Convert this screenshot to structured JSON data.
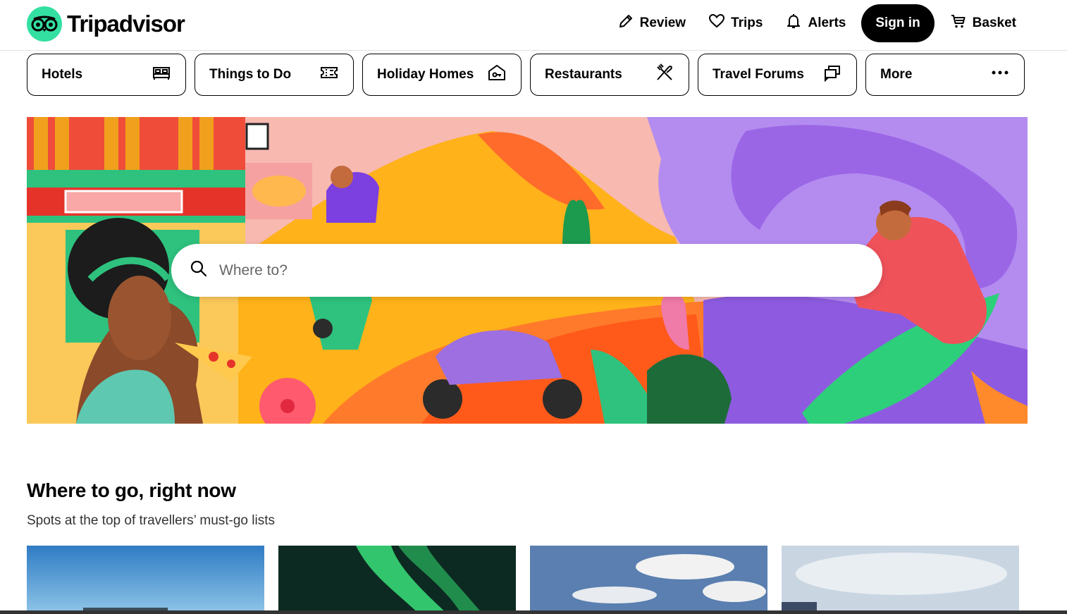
{
  "header": {
    "brand": "Tripadvisor",
    "nav": [
      {
        "label": "Review",
        "icon": "pencil-icon"
      },
      {
        "label": "Trips",
        "icon": "heart-icon"
      },
      {
        "label": "Alerts",
        "icon": "bell-icon"
      }
    ],
    "signin_label": "Sign in",
    "basket_label": "Basket"
  },
  "categories": [
    {
      "label": "Hotels",
      "icon": "bed-icon"
    },
    {
      "label": "Things to Do",
      "icon": "ticket-icon"
    },
    {
      "label": "Holiday Homes",
      "icon": "house-key-icon"
    },
    {
      "label": "Restaurants",
      "icon": "cutlery-icon"
    },
    {
      "label": "Travel Forums",
      "icon": "chat-bubbles-icon"
    },
    {
      "label": "More",
      "icon": "more-dots-icon"
    }
  ],
  "search": {
    "placeholder": "Where to?"
  },
  "section": {
    "title": "Where to go, right now",
    "subtitle": "Spots at the top of travellers’ must-go lists"
  },
  "colors": {
    "brand_green": "#34e0a1",
    "text": "#000000",
    "signin_bg": "#000000"
  }
}
